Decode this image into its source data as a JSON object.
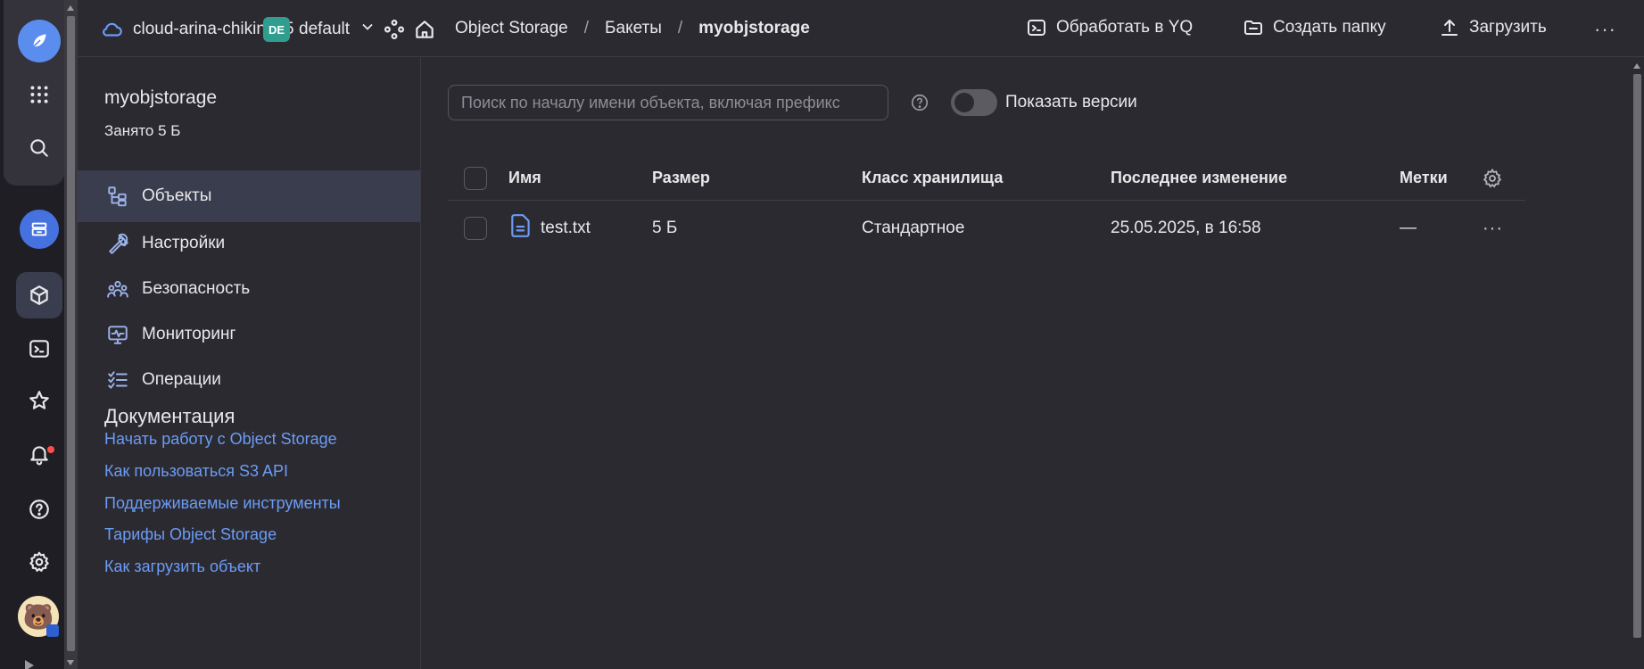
{
  "header": {
    "cloud_name": "cloud-arina-chikina05",
    "folder_badge": "DE",
    "folder_name": "default",
    "breadcrumb": [
      "Object Storage",
      "Бакеты",
      "myobjstorage"
    ],
    "breadcrumb_sep": "/",
    "actions": {
      "process_yq": "Обработать в YQ",
      "create_folder": "Создать папку",
      "upload": "Загрузить"
    },
    "more": "···"
  },
  "sidebar": {
    "bucket_name": "myobjstorage",
    "used": "Занято 5 Б",
    "items": [
      {
        "label": "Объекты",
        "icon": "objects-tree-icon",
        "active": true
      },
      {
        "label": "Настройки",
        "icon": "wrench-icon"
      },
      {
        "label": "Безопасность",
        "icon": "users-icon"
      },
      {
        "label": "Мониторинг",
        "icon": "monitor-icon"
      },
      {
        "label": "Операции",
        "icon": "checklist-icon"
      }
    ],
    "docs_title": "Документация",
    "docs_links": [
      "Начать работу с Object Storage",
      "Как пользоваться S3 API",
      "Поддерживаемые инструменты",
      "Тарифы Object Storage",
      "Как загрузить объект"
    ]
  },
  "main": {
    "search_placeholder": "Поиск по началу имени объекта, включая префикс",
    "show_versions_label": "Показать версии",
    "show_versions": false,
    "table": {
      "columns": [
        "Имя",
        "Размер",
        "Класс хранилища",
        "Последнее изменение",
        "Метки"
      ],
      "rows": [
        {
          "name": "test.txt",
          "size": "5 Б",
          "storage_class": "Стандартное",
          "modified": "25.05.2025, в 16:58",
          "labels": "—",
          "more": "···"
        }
      ]
    }
  },
  "colors": {
    "background": "#2b2a31",
    "rail": "#1f1e24",
    "accent_link": "#6b9cf5",
    "active_item": "#3a3d4d",
    "folder_badge": "#2f9e8f"
  }
}
